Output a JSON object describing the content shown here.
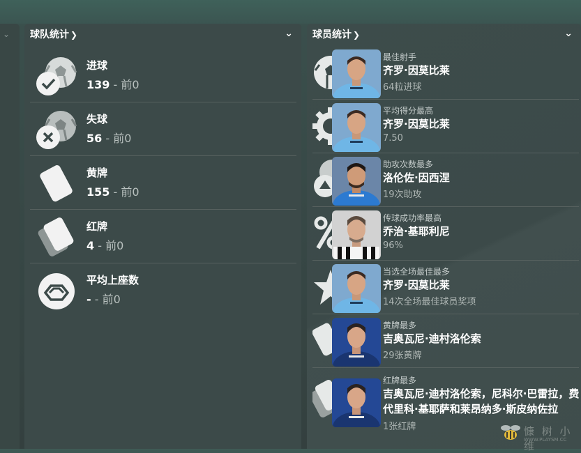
{
  "team_panel": {
    "title": "球队统计",
    "items": [
      {
        "icon": "ball-check-icon",
        "label": "进球",
        "value": "139",
        "prev": " - 前0"
      },
      {
        "icon": "ball-cross-icon",
        "label": "失球",
        "value": "56",
        "prev": " - 前0"
      },
      {
        "icon": "yellow-card-icon",
        "label": "黄牌",
        "value": "155",
        "prev": " - 前0"
      },
      {
        "icon": "red-card-icon",
        "label": "红牌",
        "value": "4",
        "prev": " - 前0"
      },
      {
        "icon": "stadium-icon",
        "label": "平均上座数",
        "value": "-",
        "prev": " - 前0"
      }
    ]
  },
  "player_panel": {
    "title": "球员统计",
    "items": [
      {
        "icon": "ball-icon",
        "category": "最佳射手",
        "name": "齐罗·因莫比莱",
        "value": "64粒进球",
        "kit": "lazio"
      },
      {
        "icon": "gear-badge-icon",
        "category": "平均得分最高",
        "name": "齐罗·因莫比莱",
        "value": "7.50",
        "kit": "lazio"
      },
      {
        "icon": "assist-ball-icon",
        "category": "助攻次数最多",
        "name": "洛伦佐·因西涅",
        "value": "19次助攻",
        "kit": "napoli"
      },
      {
        "icon": "percent-icon",
        "category": "传球成功率最高",
        "name": "乔治·基耶利尼",
        "value": "96%",
        "kit": "juventus"
      },
      {
        "icon": "star-icon",
        "category": "当选全场最佳最多",
        "name": "齐罗·因莫比莱",
        "value": "14次全场最佳球员奖项",
        "kit": "lazio"
      },
      {
        "icon": "yellow-card-icon",
        "category": "黄牌最多",
        "name": "吉奥瓦尼·迪村洛伦索",
        "value": "29张黄牌",
        "kit": "napoli-dark"
      },
      {
        "icon": "red-card-icon",
        "category": "红牌最多",
        "name": "吉奥瓦尼·迪村洛伦索，尼科尔·巴雷拉，费代里科·基耶萨和莱昂纳多·斯皮纳佐拉",
        "value": "1张红牌",
        "kit": "napoli-dark"
      }
    ]
  },
  "watermark": {
    "text": "慷 树 小 维",
    "sub": "WWW.PLAYSM.CC"
  }
}
